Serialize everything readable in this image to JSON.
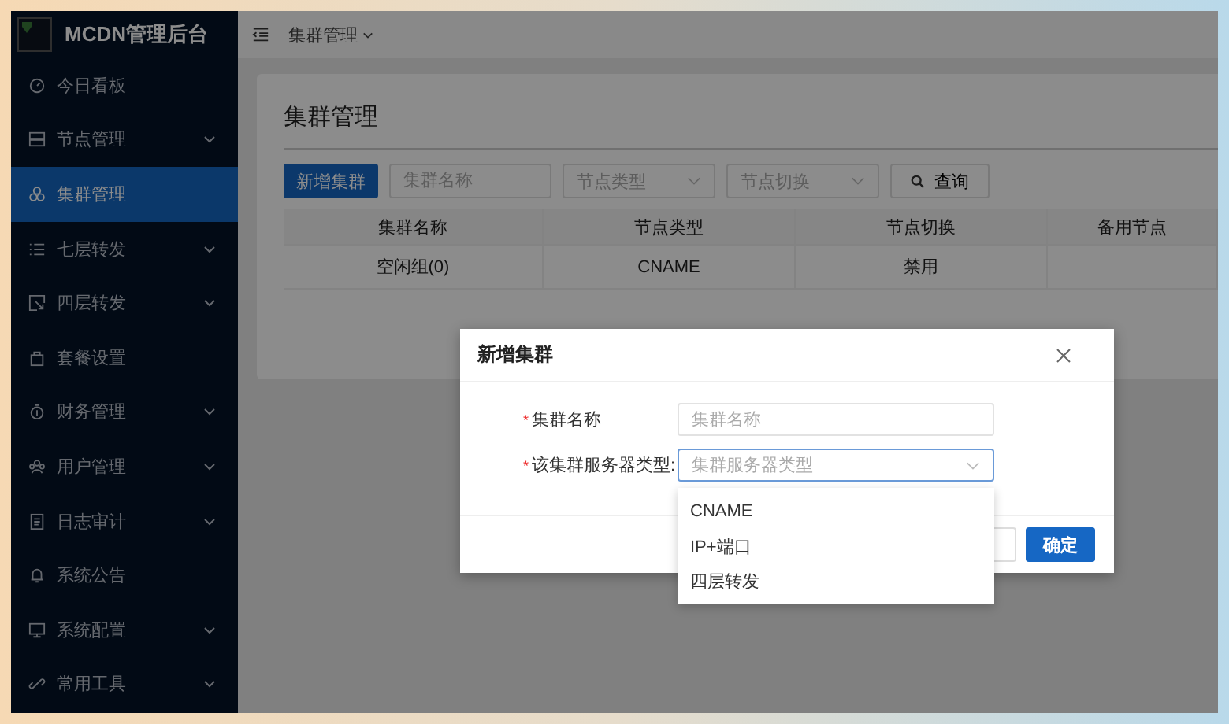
{
  "sidebar": {
    "title": "MCDN管理后台",
    "items": [
      {
        "label": "今日看板",
        "expandable": false,
        "selected": false
      },
      {
        "label": "节点管理",
        "expandable": true,
        "selected": false
      },
      {
        "label": "集群管理",
        "expandable": false,
        "selected": true
      },
      {
        "label": "七层转发",
        "expandable": true,
        "selected": false
      },
      {
        "label": "四层转发",
        "expandable": true,
        "selected": false
      },
      {
        "label": "套餐设置",
        "expandable": false,
        "selected": false
      },
      {
        "label": "财务管理",
        "expandable": true,
        "selected": false
      },
      {
        "label": "用户管理",
        "expandable": true,
        "selected": false
      },
      {
        "label": "日志审计",
        "expandable": true,
        "selected": false
      },
      {
        "label": "系统公告",
        "expandable": false,
        "selected": false
      },
      {
        "label": "系统配置",
        "expandable": true,
        "selected": false
      },
      {
        "label": "常用工具",
        "expandable": true,
        "selected": false
      }
    ]
  },
  "header": {
    "breadcrumb": "集群管理"
  },
  "page": {
    "title": "集群管理",
    "toolbar": {
      "add_button": "新增集群",
      "name_field": {
        "placeholder": "集群名称"
      },
      "type_select": {
        "placeholder": "节点类型"
      },
      "switch_select": {
        "placeholder": "节点切换"
      },
      "search_button": "查询"
    },
    "table": {
      "columns": [
        "集群名称",
        "节点类型",
        "节点切换",
        "备用节点"
      ],
      "rows": [
        {
          "cells": [
            "空闲组(0)",
            "CNAME",
            "禁用"
          ]
        }
      ]
    }
  },
  "dialog": {
    "title": "新增集群",
    "fields": [
      {
        "label": "集群名称",
        "marker": "*",
        "kind": "input",
        "placeholder": "集群名称",
        "focused": false
      },
      {
        "label": "该集群服务器类型:",
        "marker": "*",
        "kind": "select",
        "placeholder": "集群服务器类型",
        "focused": true
      }
    ],
    "dropdown": [
      "CNAME",
      "IP+端口",
      "四层转发"
    ],
    "confirm_button": "确定"
  }
}
